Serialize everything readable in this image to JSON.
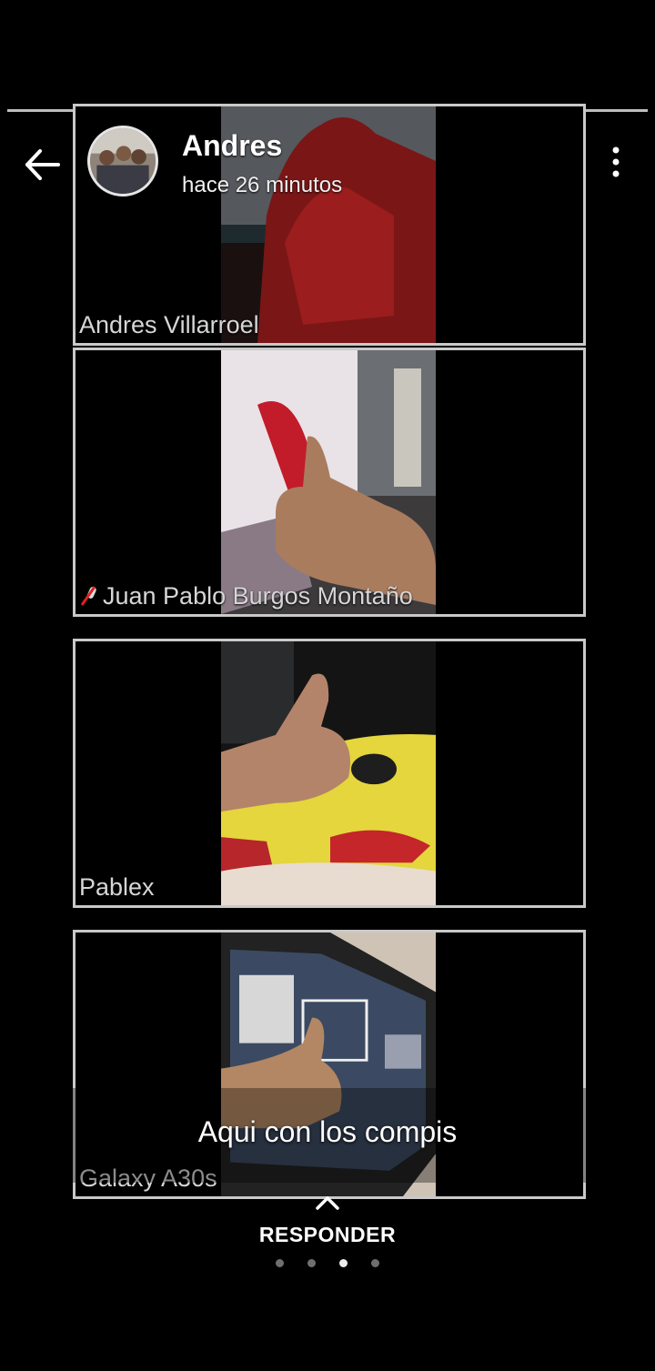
{
  "story": {
    "user_name": "Andres",
    "time_ago": "hace 26 minutos",
    "caption": "Aqui con los compis",
    "reply_label": "RESPONDER",
    "pager": {
      "count": 4,
      "active_index": 2
    }
  },
  "participants": [
    {
      "name": "Andres Villarroel"
    },
    {
      "name": "Juan Pablo Burgos Montaño",
      "muted_mic": true
    },
    {
      "name": "Pablex"
    },
    {
      "name": "Galaxy A30s"
    }
  ],
  "icons": {
    "back": "arrow-left-icon",
    "more": "more-vertical-icon",
    "reply": "chevron-up-icon",
    "mic": "mic-off-icon"
  }
}
